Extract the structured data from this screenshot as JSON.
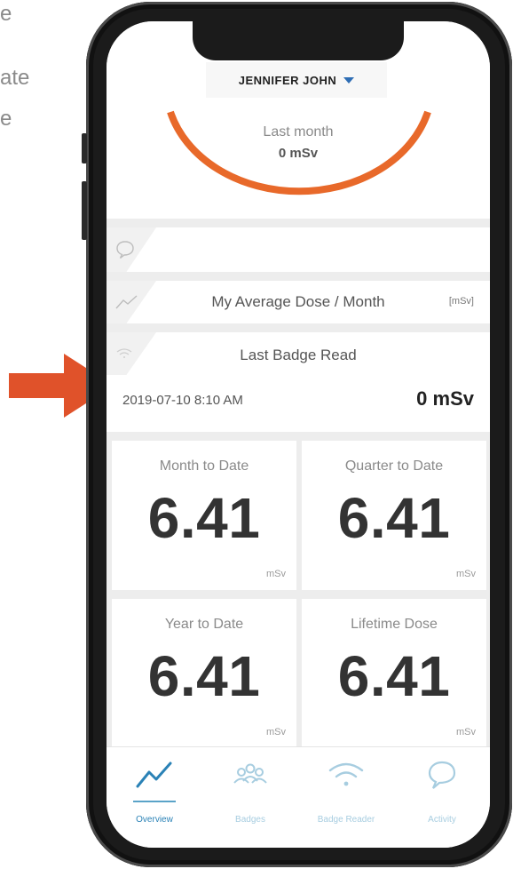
{
  "page_side_text": [
    "e",
    "ate",
    "e"
  ],
  "user": {
    "name": "JENNIFER JOHN"
  },
  "gauge": {
    "label": "Last month",
    "value": "0 mSv"
  },
  "average_row": {
    "title": "My Average Dose / Month",
    "unit": "[mSv]"
  },
  "badge_read": {
    "title": "Last Badge Read",
    "date": "2019-07-10 8:10 AM",
    "value": "0 mSv"
  },
  "tiles": [
    {
      "label": "Month to Date",
      "value": "6.41",
      "unit": "mSv"
    },
    {
      "label": "Quarter to Date",
      "value": "6.41",
      "unit": "mSv"
    },
    {
      "label": "Year to Date",
      "value": "6.41",
      "unit": "mSv"
    },
    {
      "label": "Lifetime Dose",
      "value": "6.41",
      "unit": "mSv"
    }
  ],
  "tabbar": [
    {
      "label": "Overview",
      "icon": "overview-chart-icon",
      "active": true
    },
    {
      "label": "Badges",
      "icon": "badges-group-icon",
      "active": false
    },
    {
      "label": "Badge Reader",
      "icon": "wifi-icon",
      "active": false
    },
    {
      "label": "Activity",
      "icon": "activity-bubble-icon",
      "active": false
    }
  ],
  "colors": {
    "accent": "#E8692A",
    "arrow": "#E0522A",
    "tab_active": "#2A82B6",
    "tab_inactive": "#A7CDE0"
  }
}
